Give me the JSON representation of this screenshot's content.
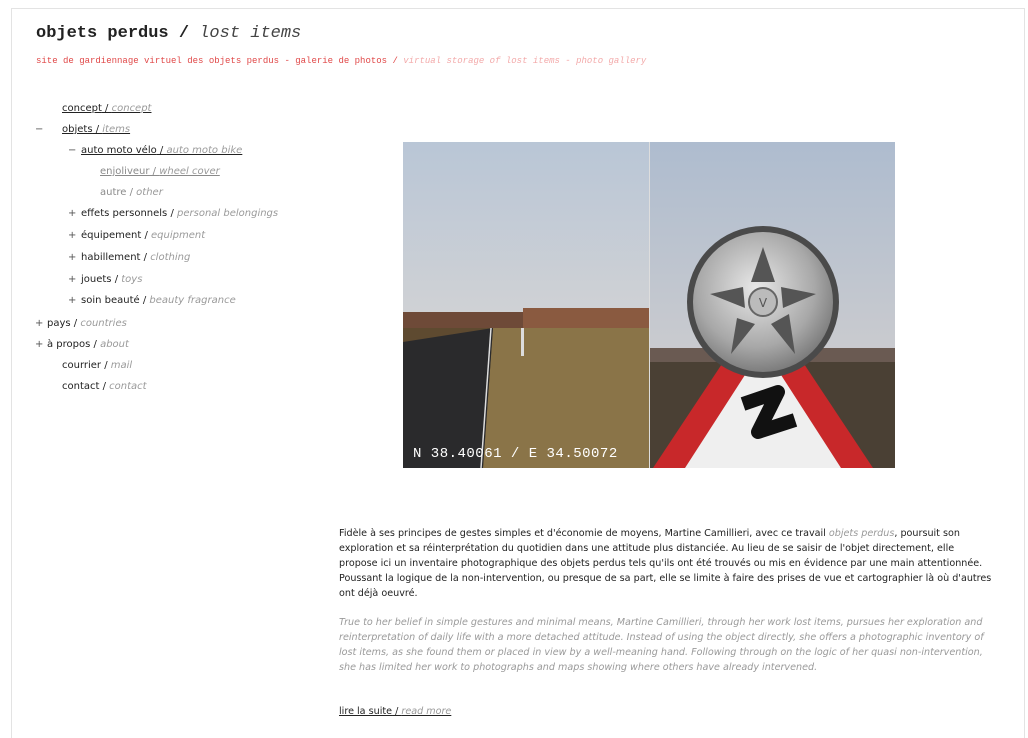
{
  "header": {
    "title_fr": "objets perdus",
    "title_sep": " / ",
    "title_en": "lost items",
    "subtitle_fr": "site de gardiennage virtuel des objets perdus - galerie de photos",
    "subtitle_sep": " / ",
    "subtitle_en": "virtual storage of lost items - photo gallery"
  },
  "nav": {
    "concept": {
      "fr": "concept",
      "en": "concept"
    },
    "objets": {
      "mark": "−",
      "fr": "objets",
      "en": "items"
    },
    "auto": {
      "mark": "−",
      "fr": "auto moto vélo",
      "en": "auto moto bike"
    },
    "enjoliveur": {
      "fr": "enjoliveur",
      "en": "wheel cover"
    },
    "autre": {
      "fr": "autre",
      "en": "other"
    },
    "effets": {
      "mark": "+",
      "fr": "effets personnels",
      "en": "personal belongings"
    },
    "equipement": {
      "mark": "+",
      "fr": "équipement",
      "en": "equipment"
    },
    "habillement": {
      "mark": "+",
      "fr": "habillement",
      "en": "clothing"
    },
    "jouets": {
      "mark": "+",
      "fr": "jouets",
      "en": "toys"
    },
    "soin": {
      "mark": "+",
      "fr": "soin beauté",
      "en": "beauty fragrance"
    },
    "pays": {
      "mark": "+",
      "fr": "pays",
      "en": "countries"
    },
    "apropos": {
      "mark": "+",
      "fr": "à propos",
      "en": "about"
    },
    "courrier": {
      "fr": "courrier",
      "en": "mail"
    },
    "contact": {
      "fr": "contact",
      "en": "contact"
    },
    "sep": " / "
  },
  "photo": {
    "coords": "N 38.40061 / E 34.50072"
  },
  "text": {
    "fr_before": "Fidèle à ses principes de gestes simples et d'économie de moyens, Martine Camillieri, avec ce travail ",
    "fr_highlight": "objets perdus",
    "fr_after": ", poursuit son exploration et sa réinterprétation du quotidien dans une attitude plus distanciée. Au lieu de se saisir de l'objet directement, elle propose ici un inventaire photographique des objets perdus tels qu'ils ont été trouvés ou mis en évidence par une main attentionnée. Poussant la logique de la non-intervention, ou presque de sa part, elle se limite à faire des prises de vue et cartographier là où d'autres ont déjà oeuvré.",
    "en": "True to her belief in simple gestures and minimal means, Martine Camillieri, through her work lost items, pursues her exploration and reinterpretation of daily life with a more detached attitude. Instead of using the object directly, she offers a photographic inventory of lost items, as she found them or placed in view by a well-meaning hand. Following through on the logic of her quasi non-intervention, she has limited her work to photographs and maps showing where others have already intervened.",
    "read_more_fr": "lire la suite",
    "read_more_sep": " / ",
    "read_more_en": "read more"
  }
}
